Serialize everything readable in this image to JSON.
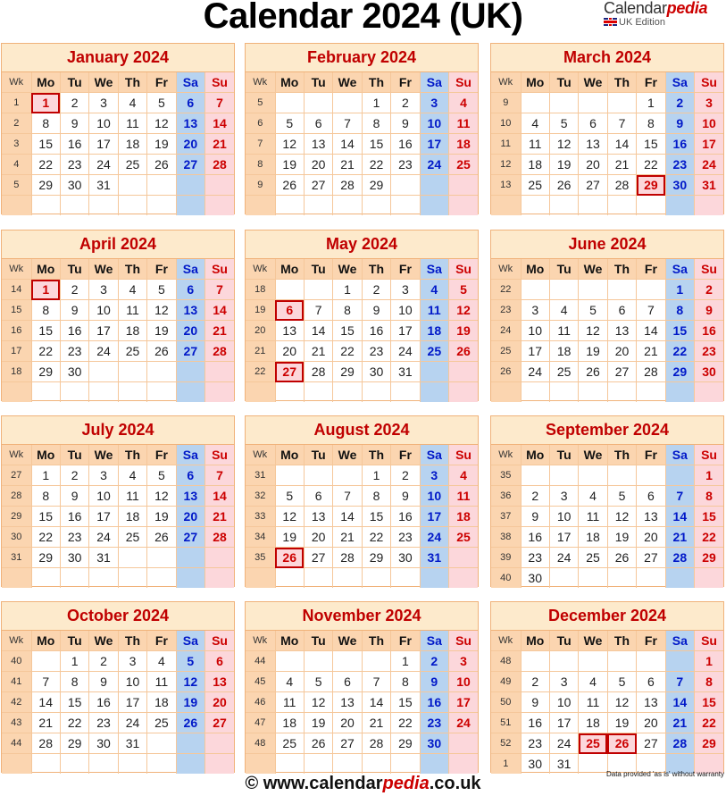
{
  "title": "Calendar 2024 (UK)",
  "logo": {
    "part1": "Calendar",
    "part2": "pedia",
    "edition": "UK Edition"
  },
  "weekday_header": {
    "wk": "Wk",
    "days": [
      "Mo",
      "Tu",
      "We",
      "Th",
      "Fr",
      "Sa",
      "Su"
    ]
  },
  "months": [
    {
      "name": "January 2024",
      "rows": [
        {
          "wk": "1",
          "days": [
            "1",
            "2",
            "3",
            "4",
            "5",
            "6",
            "7"
          ]
        },
        {
          "wk": "2",
          "days": [
            "8",
            "9",
            "10",
            "11",
            "12",
            "13",
            "14"
          ]
        },
        {
          "wk": "3",
          "days": [
            "15",
            "16",
            "17",
            "18",
            "19",
            "20",
            "21"
          ]
        },
        {
          "wk": "4",
          "days": [
            "22",
            "23",
            "24",
            "25",
            "26",
            "27",
            "28"
          ]
        },
        {
          "wk": "5",
          "days": [
            "29",
            "30",
            "31",
            "",
            "",
            "",
            ""
          ]
        },
        {
          "wk": "",
          "days": [
            "",
            "",
            "",
            "",
            "",
            "",
            ""
          ]
        }
      ],
      "holidays": [
        "1"
      ]
    },
    {
      "name": "February 2024",
      "rows": [
        {
          "wk": "5",
          "days": [
            "",
            "",
            "",
            "1",
            "2",
            "3",
            "4"
          ]
        },
        {
          "wk": "6",
          "days": [
            "5",
            "6",
            "7",
            "8",
            "9",
            "10",
            "11"
          ]
        },
        {
          "wk": "7",
          "days": [
            "12",
            "13",
            "14",
            "15",
            "16",
            "17",
            "18"
          ]
        },
        {
          "wk": "8",
          "days": [
            "19",
            "20",
            "21",
            "22",
            "23",
            "24",
            "25"
          ]
        },
        {
          "wk": "9",
          "days": [
            "26",
            "27",
            "28",
            "29",
            "",
            "",
            ""
          ]
        },
        {
          "wk": "",
          "days": [
            "",
            "",
            "",
            "",
            "",
            "",
            ""
          ]
        }
      ],
      "holidays": []
    },
    {
      "name": "March 2024",
      "rows": [
        {
          "wk": "9",
          "days": [
            "",
            "",
            "",
            "",
            "1",
            "2",
            "3"
          ]
        },
        {
          "wk": "10",
          "days": [
            "4",
            "5",
            "6",
            "7",
            "8",
            "9",
            "10"
          ]
        },
        {
          "wk": "11",
          "days": [
            "11",
            "12",
            "13",
            "14",
            "15",
            "16",
            "17"
          ]
        },
        {
          "wk": "12",
          "days": [
            "18",
            "19",
            "20",
            "21",
            "22",
            "23",
            "24"
          ]
        },
        {
          "wk": "13",
          "days": [
            "25",
            "26",
            "27",
            "28",
            "29",
            "30",
            "31"
          ]
        },
        {
          "wk": "",
          "days": [
            "",
            "",
            "",
            "",
            "",
            "",
            ""
          ]
        }
      ],
      "holidays": [
        "29"
      ]
    },
    {
      "name": "April 2024",
      "rows": [
        {
          "wk": "14",
          "days": [
            "1",
            "2",
            "3",
            "4",
            "5",
            "6",
            "7"
          ]
        },
        {
          "wk": "15",
          "days": [
            "8",
            "9",
            "10",
            "11",
            "12",
            "13",
            "14"
          ]
        },
        {
          "wk": "16",
          "days": [
            "15",
            "16",
            "17",
            "18",
            "19",
            "20",
            "21"
          ]
        },
        {
          "wk": "17",
          "days": [
            "22",
            "23",
            "24",
            "25",
            "26",
            "27",
            "28"
          ]
        },
        {
          "wk": "18",
          "days": [
            "29",
            "30",
            "",
            "",
            "",
            "",
            ""
          ]
        },
        {
          "wk": "",
          "days": [
            "",
            "",
            "",
            "",
            "",
            "",
            ""
          ]
        }
      ],
      "holidays": [
        "1"
      ]
    },
    {
      "name": "May 2024",
      "rows": [
        {
          "wk": "18",
          "days": [
            "",
            "",
            "1",
            "2",
            "3",
            "4",
            "5"
          ]
        },
        {
          "wk": "19",
          "days": [
            "6",
            "7",
            "8",
            "9",
            "10",
            "11",
            "12"
          ]
        },
        {
          "wk": "20",
          "days": [
            "13",
            "14",
            "15",
            "16",
            "17",
            "18",
            "19"
          ]
        },
        {
          "wk": "21",
          "days": [
            "20",
            "21",
            "22",
            "23",
            "24",
            "25",
            "26"
          ]
        },
        {
          "wk": "22",
          "days": [
            "27",
            "28",
            "29",
            "30",
            "31",
            "",
            ""
          ]
        },
        {
          "wk": "",
          "days": [
            "",
            "",
            "",
            "",
            "",
            "",
            ""
          ]
        }
      ],
      "holidays": [
        "6",
        "27"
      ]
    },
    {
      "name": "June 2024",
      "rows": [
        {
          "wk": "22",
          "days": [
            "",
            "",
            "",
            "",
            "",
            "1",
            "2"
          ]
        },
        {
          "wk": "23",
          "days": [
            "3",
            "4",
            "5",
            "6",
            "7",
            "8",
            "9"
          ]
        },
        {
          "wk": "24",
          "days": [
            "10",
            "11",
            "12",
            "13",
            "14",
            "15",
            "16"
          ]
        },
        {
          "wk": "25",
          "days": [
            "17",
            "18",
            "19",
            "20",
            "21",
            "22",
            "23"
          ]
        },
        {
          "wk": "26",
          "days": [
            "24",
            "25",
            "26",
            "27",
            "28",
            "29",
            "30"
          ]
        },
        {
          "wk": "",
          "days": [
            "",
            "",
            "",
            "",
            "",
            "",
            ""
          ]
        }
      ],
      "holidays": []
    },
    {
      "name": "July 2024",
      "rows": [
        {
          "wk": "27",
          "days": [
            "1",
            "2",
            "3",
            "4",
            "5",
            "6",
            "7"
          ]
        },
        {
          "wk": "28",
          "days": [
            "8",
            "9",
            "10",
            "11",
            "12",
            "13",
            "14"
          ]
        },
        {
          "wk": "29",
          "days": [
            "15",
            "16",
            "17",
            "18",
            "19",
            "20",
            "21"
          ]
        },
        {
          "wk": "30",
          "days": [
            "22",
            "23",
            "24",
            "25",
            "26",
            "27",
            "28"
          ]
        },
        {
          "wk": "31",
          "days": [
            "29",
            "30",
            "31",
            "",
            "",
            "",
            ""
          ]
        },
        {
          "wk": "",
          "days": [
            "",
            "",
            "",
            "",
            "",
            "",
            ""
          ]
        }
      ],
      "holidays": []
    },
    {
      "name": "August 2024",
      "rows": [
        {
          "wk": "31",
          "days": [
            "",
            "",
            "",
            "1",
            "2",
            "3",
            "4"
          ]
        },
        {
          "wk": "32",
          "days": [
            "5",
            "6",
            "7",
            "8",
            "9",
            "10",
            "11"
          ]
        },
        {
          "wk": "33",
          "days": [
            "12",
            "13",
            "14",
            "15",
            "16",
            "17",
            "18"
          ]
        },
        {
          "wk": "34",
          "days": [
            "19",
            "20",
            "21",
            "22",
            "23",
            "24",
            "25"
          ]
        },
        {
          "wk": "35",
          "days": [
            "26",
            "27",
            "28",
            "29",
            "30",
            "31",
            ""
          ]
        },
        {
          "wk": "",
          "days": [
            "",
            "",
            "",
            "",
            "",
            "",
            ""
          ]
        }
      ],
      "holidays": [
        "26"
      ]
    },
    {
      "name": "September 2024",
      "rows": [
        {
          "wk": "35",
          "days": [
            "",
            "",
            "",
            "",
            "",
            "",
            "1"
          ]
        },
        {
          "wk": "36",
          "days": [
            "2",
            "3",
            "4",
            "5",
            "6",
            "7",
            "8"
          ]
        },
        {
          "wk": "37",
          "days": [
            "9",
            "10",
            "11",
            "12",
            "13",
            "14",
            "15"
          ]
        },
        {
          "wk": "38",
          "days": [
            "16",
            "17",
            "18",
            "19",
            "20",
            "21",
            "22"
          ]
        },
        {
          "wk": "39",
          "days": [
            "23",
            "24",
            "25",
            "26",
            "27",
            "28",
            "29"
          ]
        },
        {
          "wk": "40",
          "days": [
            "30",
            "",
            "",
            "",
            "",
            "",
            ""
          ]
        }
      ],
      "holidays": []
    },
    {
      "name": "October 2024",
      "rows": [
        {
          "wk": "40",
          "days": [
            "",
            "1",
            "2",
            "3",
            "4",
            "5",
            "6"
          ]
        },
        {
          "wk": "41",
          "days": [
            "7",
            "8",
            "9",
            "10",
            "11",
            "12",
            "13"
          ]
        },
        {
          "wk": "42",
          "days": [
            "14",
            "15",
            "16",
            "17",
            "18",
            "19",
            "20"
          ]
        },
        {
          "wk": "43",
          "days": [
            "21",
            "22",
            "23",
            "24",
            "25",
            "26",
            "27"
          ]
        },
        {
          "wk": "44",
          "days": [
            "28",
            "29",
            "30",
            "31",
            "",
            "",
            ""
          ]
        },
        {
          "wk": "",
          "days": [
            "",
            "",
            "",
            "",
            "",
            "",
            ""
          ]
        }
      ],
      "holidays": []
    },
    {
      "name": "November 2024",
      "rows": [
        {
          "wk": "44",
          "days": [
            "",
            "",
            "",
            "",
            "1",
            "2",
            "3"
          ]
        },
        {
          "wk": "45",
          "days": [
            "4",
            "5",
            "6",
            "7",
            "8",
            "9",
            "10"
          ]
        },
        {
          "wk": "46",
          "days": [
            "11",
            "12",
            "13",
            "14",
            "15",
            "16",
            "17"
          ]
        },
        {
          "wk": "47",
          "days": [
            "18",
            "19",
            "20",
            "21",
            "22",
            "23",
            "24"
          ]
        },
        {
          "wk": "48",
          "days": [
            "25",
            "26",
            "27",
            "28",
            "29",
            "30",
            ""
          ]
        },
        {
          "wk": "",
          "days": [
            "",
            "",
            "",
            "",
            "",
            "",
            ""
          ]
        }
      ],
      "holidays": []
    },
    {
      "name": "December 2024",
      "rows": [
        {
          "wk": "48",
          "days": [
            "",
            "",
            "",
            "",
            "",
            "",
            "1"
          ]
        },
        {
          "wk": "49",
          "days": [
            "2",
            "3",
            "4",
            "5",
            "6",
            "7",
            "8"
          ]
        },
        {
          "wk": "50",
          "days": [
            "9",
            "10",
            "11",
            "12",
            "13",
            "14",
            "15"
          ]
        },
        {
          "wk": "51",
          "days": [
            "16",
            "17",
            "18",
            "19",
            "20",
            "21",
            "22"
          ]
        },
        {
          "wk": "52",
          "days": [
            "23",
            "24",
            "25",
            "26",
            "27",
            "28",
            "29"
          ]
        },
        {
          "wk": "1",
          "days": [
            "30",
            "31",
            "",
            "",
            "",
            "",
            ""
          ]
        }
      ],
      "holidays": [
        "25",
        "26"
      ]
    }
  ],
  "warranty": "Data provided 'as is' without warranty",
  "footer": {
    "prefix": "© www.calendar",
    "brand": "pedia",
    "suffix": ".co.uk"
  },
  "colors": {
    "title_red": "#c00000",
    "saturday_blue": "#0018c8",
    "header_orange": "#fbd5b0",
    "title_bg": "#fdeacc",
    "sat_bg": "#b7d3f0",
    "sun_bg": "#fcd7db"
  }
}
